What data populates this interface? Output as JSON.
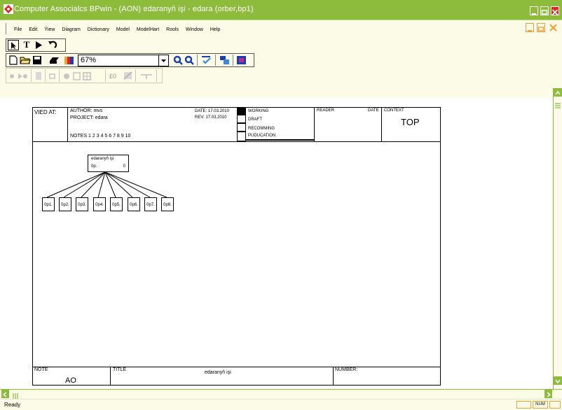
{
  "app": {
    "title": "Computer Associalcs BPwin - (AON) edaranyň işi - edara (orber,bp1)"
  },
  "menu": {
    "items": [
      "File",
      "Edit",
      "Ýiew",
      "Diagram",
      "Dictionary",
      "Model",
      "ModelHart",
      "Rools",
      "Window",
      "Help"
    ]
  },
  "toolbar": {
    "zoom_value": "67%"
  },
  "diagram": {
    "header": {
      "used_at": "VIED AT:",
      "author": "AUTHOR: mvs",
      "project": "PROJECT: edara",
      "notes": "NOTES  1  2  3  4  5  6  7  8  9  10",
      "date": "DATE:  17.03.2010",
      "rev": "REV:  17.03.2010",
      "status": [
        "WORKING",
        "DRAFT",
        "RECOMMING",
        "PUDUCATION"
      ],
      "reader": "READER",
      "reader_date": "DATE",
      "context_label": "CONTEXT",
      "context_value": "TOP"
    },
    "root_node": {
      "label": "edaranyň işi",
      "number": "0p.",
      "cost": "0"
    },
    "child_nodes": [
      "0p1.",
      "0p2.",
      "0p3.",
      "0p4.",
      "0p5.",
      "0p6.",
      "0p7.",
      "0p8."
    ],
    "footer": {
      "node_label": "NOTE",
      "node_value": "AO",
      "title_label": "TITLE",
      "title_value": "edaranyň işi",
      "number_label": "NUMBER:"
    }
  },
  "status": {
    "text": "Ready",
    "num": "NUM"
  },
  "colors": {
    "title_bar": "#8dbb3c",
    "chrome_bg": "#fbfbe8",
    "accent_orange": "#f2a13a"
  }
}
